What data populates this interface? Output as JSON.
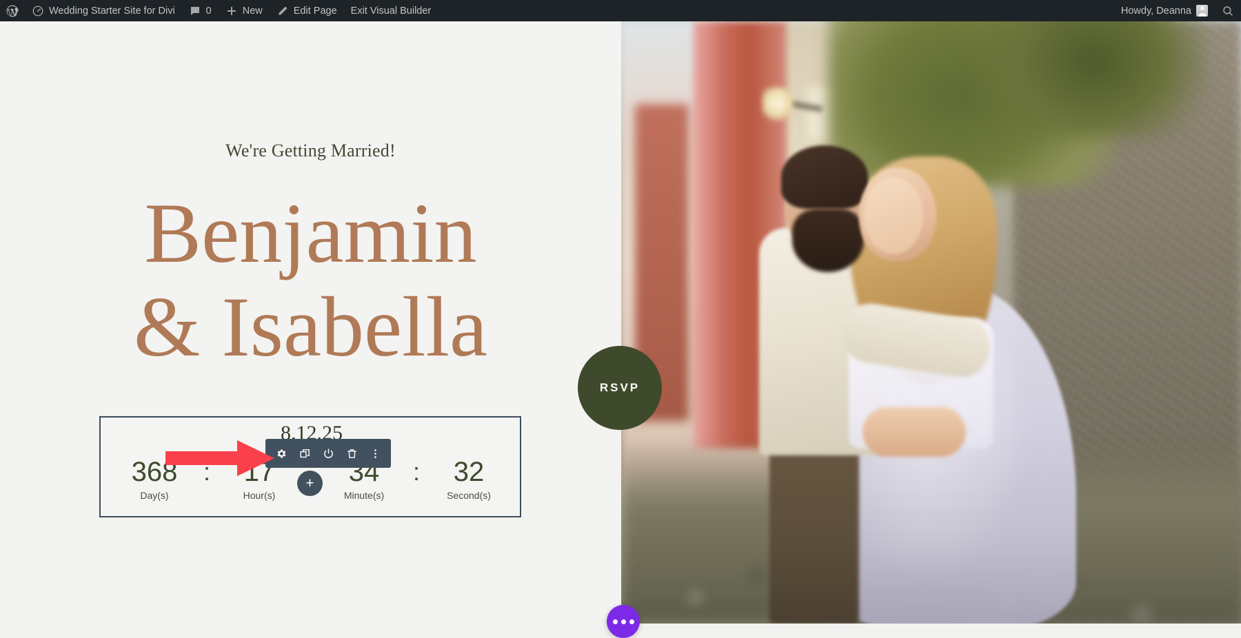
{
  "adminbar": {
    "logo_icon": "wordpress-logo-icon",
    "site_icon": "dashboard-icon",
    "site_name": "Wedding Starter Site for Divi",
    "comments_icon": "comment-bubble-icon",
    "comments_count": "0",
    "new_icon": "plus-icon",
    "new_label": "New",
    "edit_icon": "pencil-icon",
    "edit_label": "Edit Page",
    "exit_label": "Exit Visual Builder",
    "howdy": "Howdy, Deanna",
    "avatar_icon": "user-avatar-icon",
    "search_icon": "search-icon"
  },
  "builder": {
    "section_bar": {
      "color": "#2ea3f2",
      "buttons": [
        {
          "name": "move-section",
          "icon": "move-arrows-icon"
        },
        {
          "name": "section-settings",
          "icon": "gear-icon"
        },
        {
          "name": "duplicate-section",
          "icon": "duplicate-icon"
        },
        {
          "name": "disable-section",
          "icon": "power-icon"
        },
        {
          "name": "delete-section",
          "icon": "trash-icon"
        }
      ]
    },
    "row_bar": {
      "color": "#2ecfa5",
      "buttons": [
        {
          "name": "move-row",
          "icon": "move-arrows-icon"
        },
        {
          "name": "row-settings",
          "icon": "gear-icon"
        },
        {
          "name": "duplicate-row",
          "icon": "duplicate-icon"
        },
        {
          "name": "row-columns",
          "icon": "columns-icon"
        },
        {
          "name": "disable-row",
          "icon": "power-icon"
        },
        {
          "name": "delete-row",
          "icon": "trash-icon"
        },
        {
          "name": "row-more-options",
          "icon": "more-vertical-icon"
        }
      ]
    },
    "module_toolbar": {
      "color": "#42515f",
      "buttons": [
        {
          "name": "module-settings",
          "icon": "gear-icon"
        },
        {
          "name": "duplicate-module",
          "icon": "duplicate-icon"
        },
        {
          "name": "disable-module",
          "icon": "power-icon"
        },
        {
          "name": "delete-module",
          "icon": "trash-icon"
        },
        {
          "name": "module-more-options",
          "icon": "more-vertical-icon"
        }
      ]
    },
    "add_module_label": "+",
    "fab_icon": "divi-menu-dots-icon",
    "fab_color": "#7d2ae8"
  },
  "hero": {
    "eyebrow": "We're Getting Married!",
    "name_line1": "Benjamin",
    "name_line2": "& Isabella",
    "names_color": "#b07a57",
    "eyebrow_color": "#3f4a32"
  },
  "countdown": {
    "title": "8.12.25",
    "separator": ":",
    "units": [
      {
        "value": "368",
        "label": "Day(s)"
      },
      {
        "value": "17",
        "label": "Hour(s)"
      },
      {
        "value": "34",
        "label": "Minute(s)"
      },
      {
        "value": "32",
        "label": "Second(s)"
      }
    ],
    "border_color": "#3e4d5c",
    "value_color": "#3e4a2e"
  },
  "rsvp": {
    "label": "RSVP",
    "color": "#3f4a2c"
  },
  "annotation": {
    "arrow_color": "#f9404b",
    "points_to": "module-settings"
  }
}
